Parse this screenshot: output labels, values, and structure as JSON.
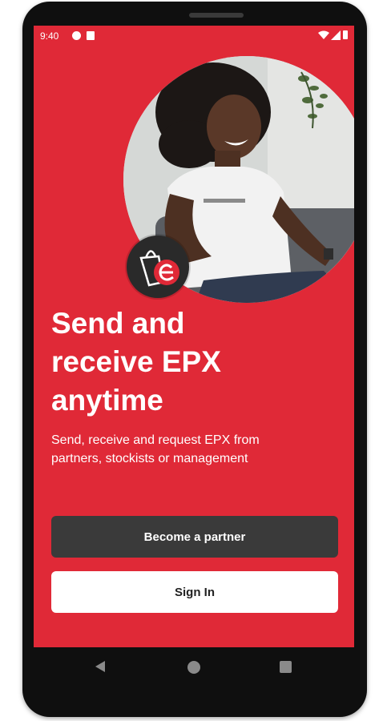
{
  "status_bar": {
    "time": "9:40",
    "icons": [
      "notification-p-icon",
      "sim-card-icon",
      "wifi-icon",
      "signal-icon",
      "battery-icon"
    ]
  },
  "hero": {
    "image": "smiling-woman-photo",
    "logo_icon": "epx-shopping-bag-logo-icon"
  },
  "headline": {
    "lines": [
      "Send and",
      "receive EPX",
      "anytime"
    ]
  },
  "subtext": {
    "lines": [
      "Send, receive and request EPX from",
      "partners, stockists or management"
    ]
  },
  "buttons": {
    "partner_label": "Become a partner",
    "signin_label": "Sign In"
  },
  "nav_bar": {
    "icons": [
      "back-icon",
      "home-icon",
      "recents-icon"
    ]
  },
  "colors": {
    "background": "#e02937",
    "primary_button": "#3a3a3a",
    "secondary_button": "#ffffff",
    "text": "#ffffff"
  }
}
